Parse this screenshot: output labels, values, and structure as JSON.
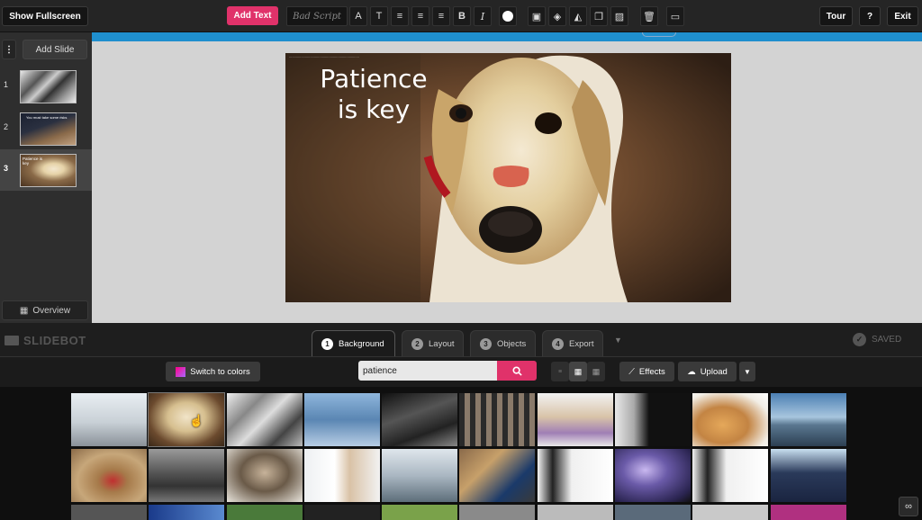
{
  "topbar": {
    "fullscreen_label": "Show Fullscreen",
    "add_text_label": "Add Text",
    "font_name": "Bad Script",
    "tour_label": "Tour",
    "help_label": "?",
    "exit_label": "Exit"
  },
  "sidebar": {
    "add_slide_label": "Add Slide",
    "menu_glyph": "⋮",
    "slides": [
      {
        "number": "1",
        "caption": ""
      },
      {
        "number": "2",
        "caption": "You must take some risks"
      },
      {
        "number": "3",
        "caption": "Patience is key"
      }
    ],
    "overview_label": "Overview"
  },
  "slide": {
    "title_line1": "Patience",
    "title_line2": "is key"
  },
  "brand": {
    "name": "SLIDEBOT"
  },
  "tabs": [
    {
      "number": "1",
      "label": "Background"
    },
    {
      "number": "2",
      "label": "Layout"
    },
    {
      "number": "3",
      "label": "Objects"
    },
    {
      "number": "4",
      "label": "Export"
    }
  ],
  "status": {
    "saved_label": "SAVED"
  },
  "toolbar2": {
    "switch_colors_label": "Switch to colors",
    "search_value": "patience",
    "effects_label": "Effects",
    "upload_label": "Upload"
  },
  "colors": {
    "accent": "#e0326a",
    "blue": "#1f8fce"
  }
}
